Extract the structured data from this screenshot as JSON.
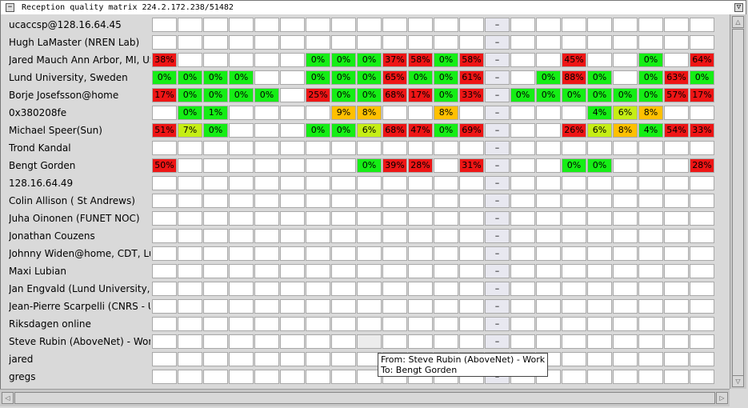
{
  "window": {
    "title": "Reception quality matrix 224.2.172.238/51482",
    "menu_glyph": "−",
    "maximize_glyph": "▽"
  },
  "colors": {
    "green": "#15ee15",
    "yellow": "#c5ee15",
    "orange": "#ffc000",
    "red": "#ee1515",
    "empty": "#ffffff",
    "self": "#e8e8f0"
  },
  "columns": 22,
  "rows": [
    {
      "label": "ucaccsp@128.16.64.45",
      "cells": [
        "",
        "",
        "",
        "",
        "",
        "",
        "",
        "",
        "",
        "",
        "",
        "",
        "",
        "",
        "",
        "",
        "",
        "",
        "",
        "",
        "",
        ""
      ]
    },
    {
      "label": "Hugh LaMaster (NREN Lab)",
      "cells": [
        "",
        "",
        "",
        "",
        "",
        "",
        "",
        "",
        "",
        "",
        "",
        "",
        "",
        "",
        "",
        "",
        "",
        "",
        "",
        "",
        "",
        ""
      ]
    },
    {
      "label": "Jared Mauch Ann Arbor, MI, US",
      "cells": [
        "38%",
        "",
        "",
        "",
        "",
        "",
        "0%",
        "0%",
        "0%",
        "37%",
        "58%",
        "0%",
        "58%",
        "",
        "",
        "",
        "45%",
        "",
        "",
        "0%",
        "",
        "64%"
      ]
    },
    {
      "label": "Lund University, Sweden",
      "cells": [
        "0%",
        "0%",
        "0%",
        "0%",
        "",
        "",
        "0%",
        "0%",
        "0%",
        "65%",
        "0%",
        "0%",
        "61%",
        "",
        "",
        "0%",
        "88%",
        "0%",
        "",
        "0%",
        "63%",
        "0%"
      ]
    },
    {
      "label": "Borje Josefsson@home",
      "cells": [
        "17%",
        "0%",
        "0%",
        "0%",
        "0%",
        "",
        "25%",
        "0%",
        "0%",
        "68%",
        "17%",
        "0%",
        "33%",
        "",
        "0%",
        "0%",
        "0%",
        "0%",
        "0%",
        "0%",
        "57%",
        "17%"
      ]
    },
    {
      "label": "0x380208fe",
      "cells": [
        "",
        "0%",
        "1%",
        "",
        "",
        "",
        "",
        "9%",
        "8%",
        "",
        "",
        "8%",
        "",
        "",
        "",
        "",
        "",
        "4%",
        "6%",
        "8%",
        "",
        ""
      ]
    },
    {
      "label": "Michael Speer(Sun)",
      "cells": [
        "51%",
        "7%",
        "0%",
        "",
        "",
        "",
        "0%",
        "0%",
        "6%",
        "68%",
        "47%",
        "0%",
        "69%",
        "",
        "",
        "",
        "26%",
        "6%",
        "8%",
        "4%",
        "54%",
        "33%"
      ]
    },
    {
      "label": "Trond Kandal",
      "cells": [
        "",
        "",
        "",
        "",
        "",
        "",
        "",
        "",
        "",
        "",
        "",
        "",
        "",
        "",
        "",
        "",
        "",
        "",
        "",
        "",
        "",
        ""
      ]
    },
    {
      "label": "Bengt Gorden",
      "cells": [
        "50%",
        "",
        "",
        "",
        "",
        "",
        "",
        "",
        "0%",
        "39%",
        "28%",
        "",
        "31%",
        "",
        "",
        "",
        "0%",
        "0%",
        "",
        "",
        "",
        "28%"
      ]
    },
    {
      "label": "128.16.64.49",
      "cells": [
        "",
        "",
        "",
        "",
        "",
        "",
        "",
        "",
        "",
        "",
        "",
        "",
        "",
        "",
        "",
        "",
        "",
        "",
        "",
        "",
        "",
        ""
      ]
    },
    {
      "label": "Colin Allison ( St Andrews)",
      "cells": [
        "",
        "",
        "",
        "",
        "",
        "",
        "",
        "",
        "",
        "",
        "",
        "",
        "",
        "",
        "",
        "",
        "",
        "",
        "",
        "",
        "",
        ""
      ]
    },
    {
      "label": "Juha Oinonen (FUNET NOC)",
      "cells": [
        "",
        "",
        "",
        "",
        "",
        "",
        "",
        "",
        "",
        "",
        "",
        "",
        "",
        "",
        "",
        "",
        "",
        "",
        "",
        "",
        "",
        ""
      ]
    },
    {
      "label": "Jonathan Couzens",
      "cells": [
        "",
        "",
        "",
        "",
        "",
        "",
        "",
        "",
        "",
        "",
        "",
        "",
        "",
        "",
        "",
        "",
        "",
        "",
        "",
        "",
        "",
        ""
      ]
    },
    {
      "label": "Johnny Widen@home, CDT, Lulea",
      "cells": [
        "",
        "",
        "",
        "",
        "",
        "",
        "",
        "",
        "",
        "",
        "",
        "",
        "",
        "",
        "",
        "",
        "",
        "",
        "",
        "",
        "",
        ""
      ]
    },
    {
      "label": "Maxi Lubian",
      "cells": [
        "",
        "",
        "",
        "",
        "",
        "",
        "",
        "",
        "",
        "",
        "",
        "",
        "",
        "",
        "",
        "",
        "",
        "",
        "",
        "",
        "",
        ""
      ]
    },
    {
      "label": "Jan Engvald (Lund University, Sweden)",
      "cells": [
        "",
        "",
        "",
        "",
        "",
        "",
        "",
        "",
        "",
        "",
        "",
        "",
        "",
        "",
        "",
        "",
        "",
        "",
        "",
        "",
        "",
        ""
      ]
    },
    {
      "label": "Jean-Pierre Scarpelli (CNRS - UREC)",
      "cells": [
        "",
        "",
        "",
        "",
        "",
        "",
        "",
        "",
        "",
        "",
        "",
        "",
        "",
        "",
        "",
        "",
        "",
        "",
        "",
        "",
        "",
        ""
      ]
    },
    {
      "label": "Riksdagen online",
      "cells": [
        "",
        "",
        "",
        "",
        "",
        "",
        "",
        "",
        "",
        "",
        "",
        "",
        "",
        "",
        "",
        "",
        "",
        "",
        "",
        "",
        "",
        ""
      ]
    },
    {
      "label": "Steve Rubin (AboveNet) - Work",
      "cells": [
        "",
        "",
        "",
        "",
        "",
        "",
        "",
        "",
        "",
        "",
        "",
        "",
        "",
        "",
        "",
        "",
        "",
        "",
        "",
        "",
        "",
        ""
      ]
    },
    {
      "label": "jared",
      "cells": [
        "",
        "",
        "",
        "",
        "",
        "",
        "",
        "",
        "",
        "",
        "",
        "",
        "",
        "",
        "",
        "",
        "",
        "",
        "",
        "",
        "",
        ""
      ]
    },
    {
      "label": "gregs",
      "cells": [
        "",
        "",
        "",
        "",
        "",
        "",
        "",
        "",
        "",
        "",
        "",
        "",
        "",
        "",
        "",
        "",
        "",
        "",
        "",
        "",
        "",
        ""
      ]
    }
  ],
  "self_column_index": 13,
  "self_marker": "–",
  "highlight_row_index": 18,
  "highlight_column_index": 8,
  "tooltip": {
    "from": "From: Steve Rubin (AboveNet) - Work",
    "to": "To: Bengt Gorden"
  },
  "scrollbars": {
    "up": "△",
    "down": "▽",
    "left": "◁",
    "right": "▷"
  }
}
